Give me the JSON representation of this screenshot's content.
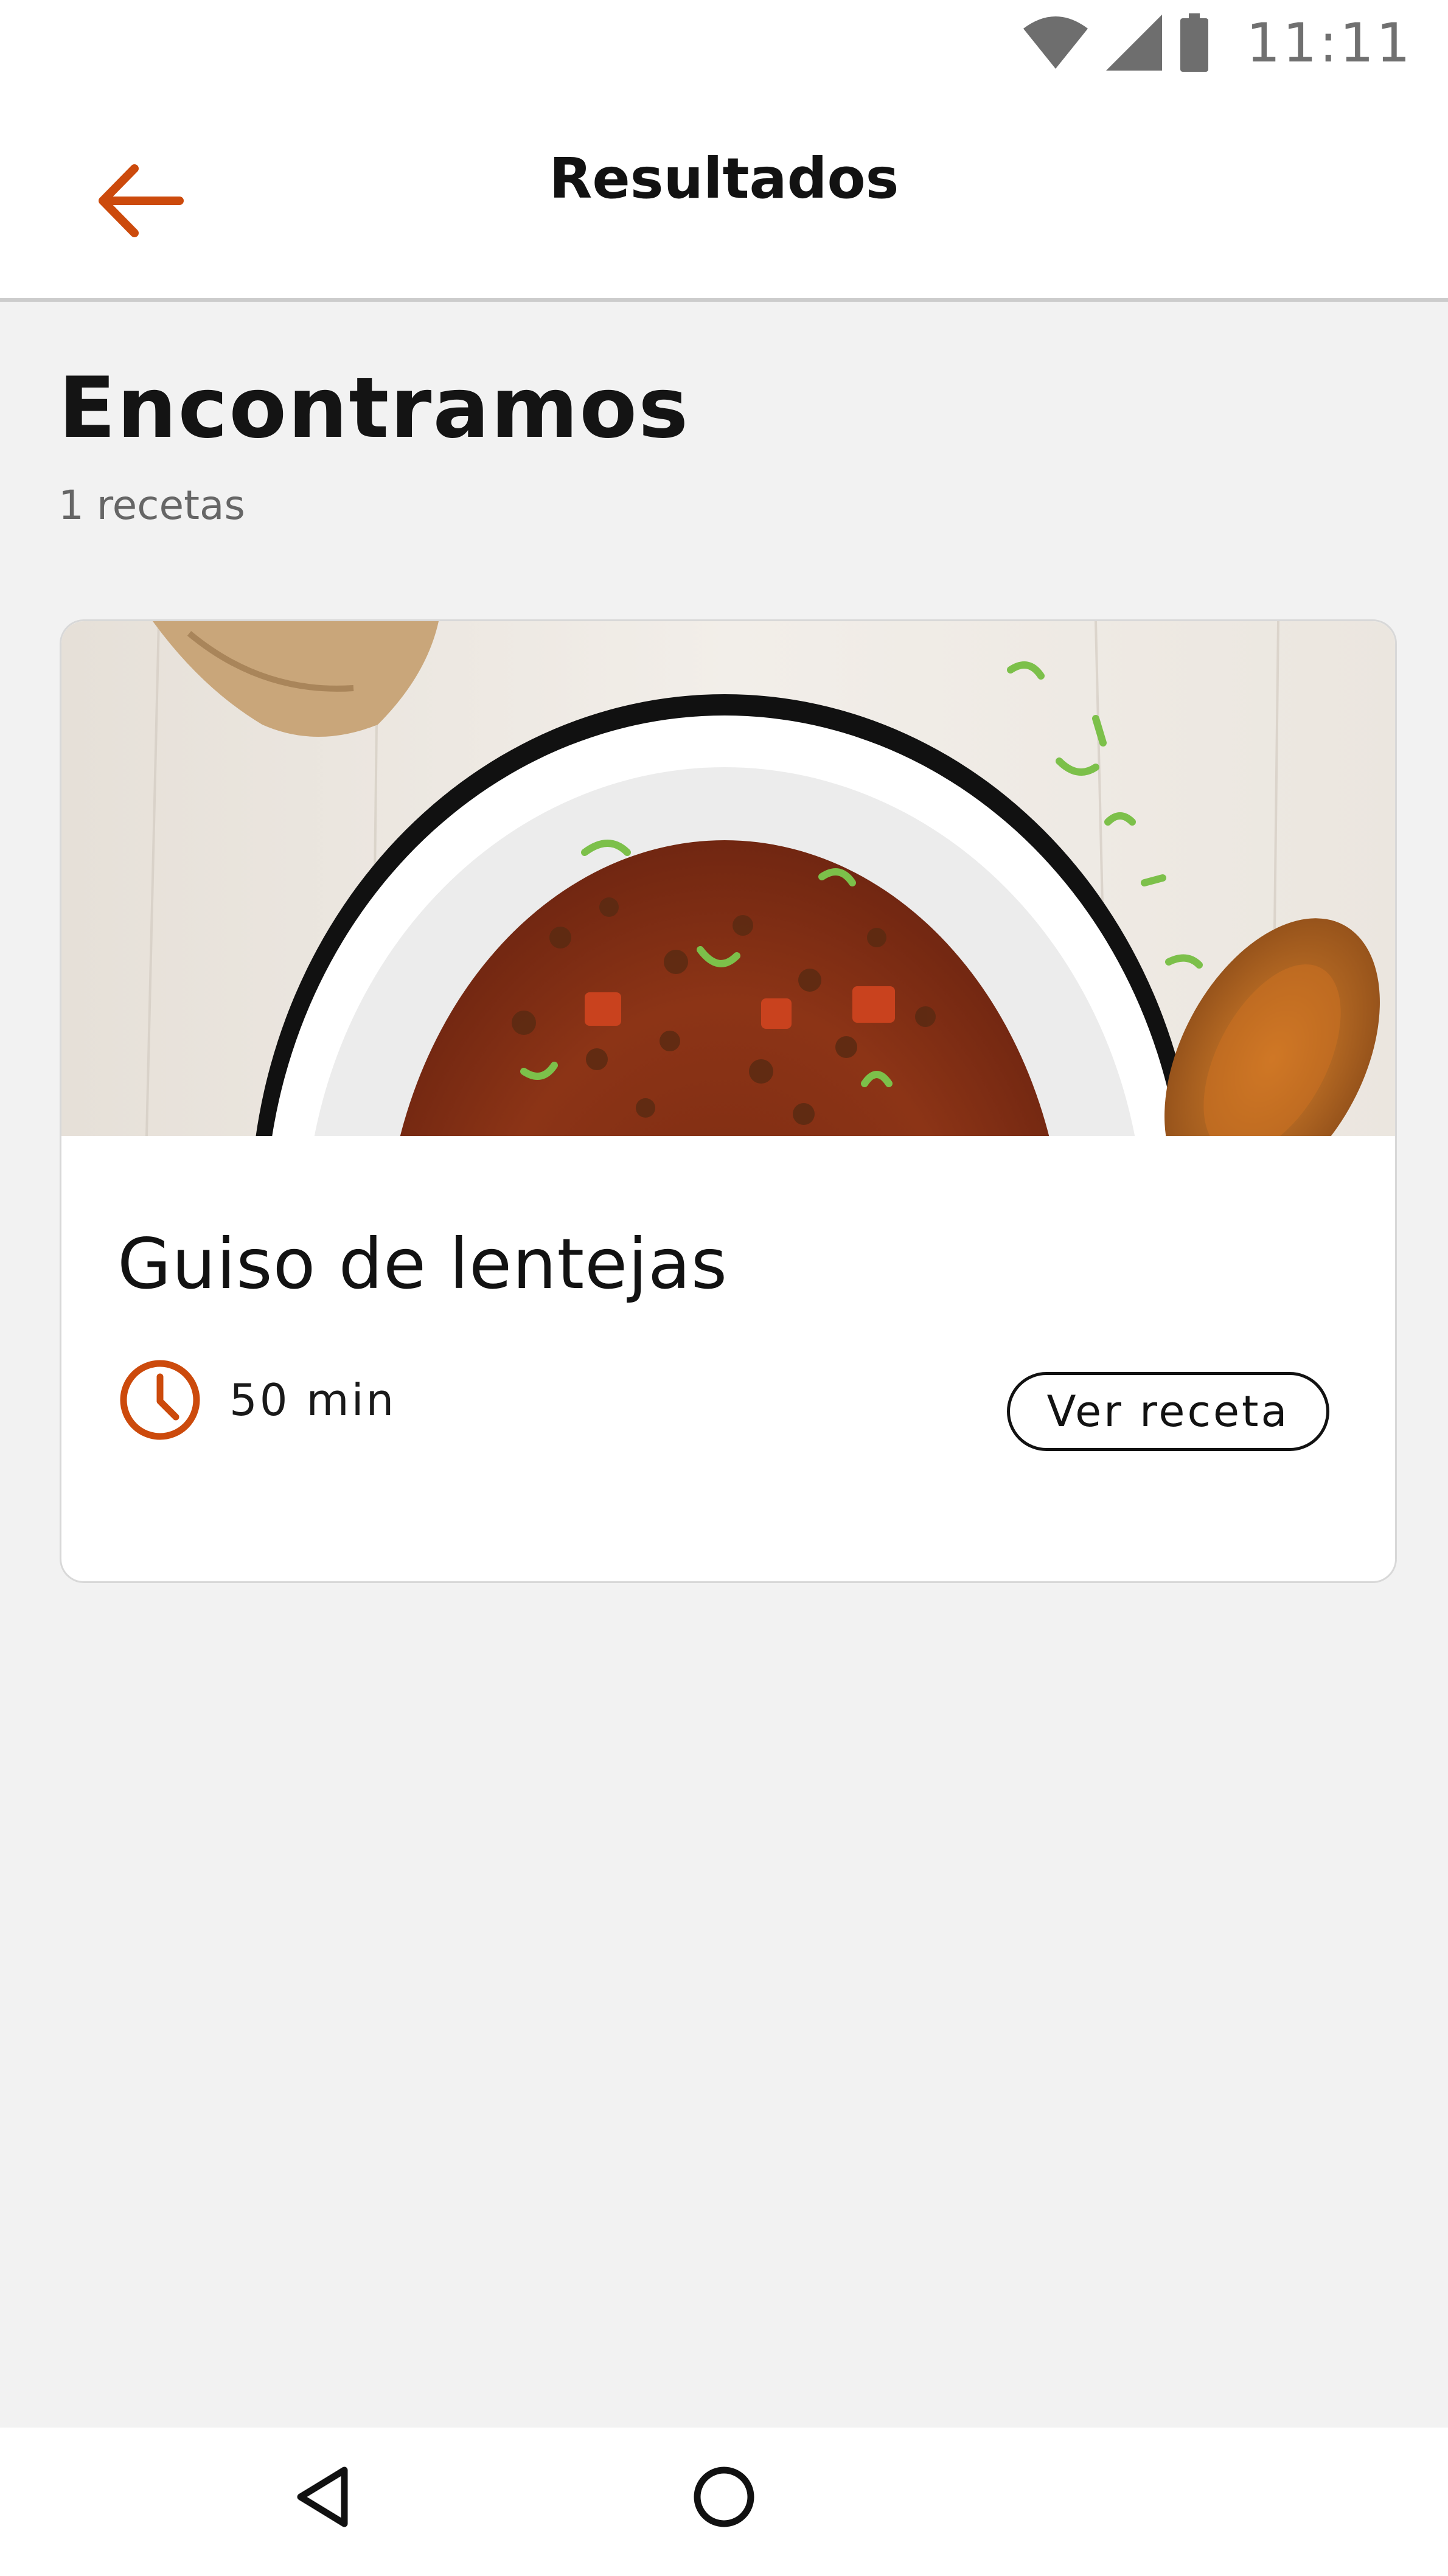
{
  "status_bar": {
    "time": "11:11",
    "icons": [
      "wifi-icon",
      "signal-icon",
      "battery-icon"
    ]
  },
  "app_bar": {
    "title": "Resultados",
    "back_icon": "arrow-left-icon",
    "accent_color": "#cc4a0c"
  },
  "results": {
    "heading": "Encontramos",
    "count_text": "1 recetas"
  },
  "recipes": [
    {
      "title": "Guiso de lentejas",
      "time": "50 min",
      "button_label": "Ver receta",
      "image": "lentil-stew-photo"
    }
  ],
  "nav_bar": {
    "icons": [
      "nav-back-icon",
      "nav-home-icon"
    ]
  }
}
